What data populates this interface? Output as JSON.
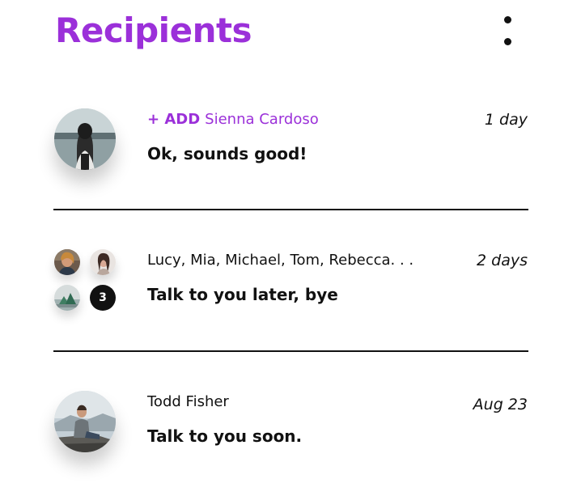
{
  "theme": {
    "accent": "#9b30d9",
    "text": "#111111",
    "divider": "#111111",
    "badge_bg": "#111111"
  },
  "header": {
    "title": "Recipients",
    "menu_icon": "more-vertical-icon"
  },
  "conversations": [
    {
      "add_label": "+ ADD",
      "name": "Sienna Cardoso",
      "time": "1 day",
      "message": "Ok, sounds good!",
      "avatar_icon": "person-photo-avatar"
    },
    {
      "name": "Lucy, Mia, Michael, Tom, Rebecca. . .",
      "time": "2 days",
      "message": "Talk to you later, bye",
      "extra_count": "3",
      "avatar_icon": "group-photo-avatars"
    },
    {
      "name": "Todd Fisher",
      "time": "Aug 23",
      "message": "Talk to you soon.",
      "avatar_icon": "person-photo-avatar"
    }
  ]
}
